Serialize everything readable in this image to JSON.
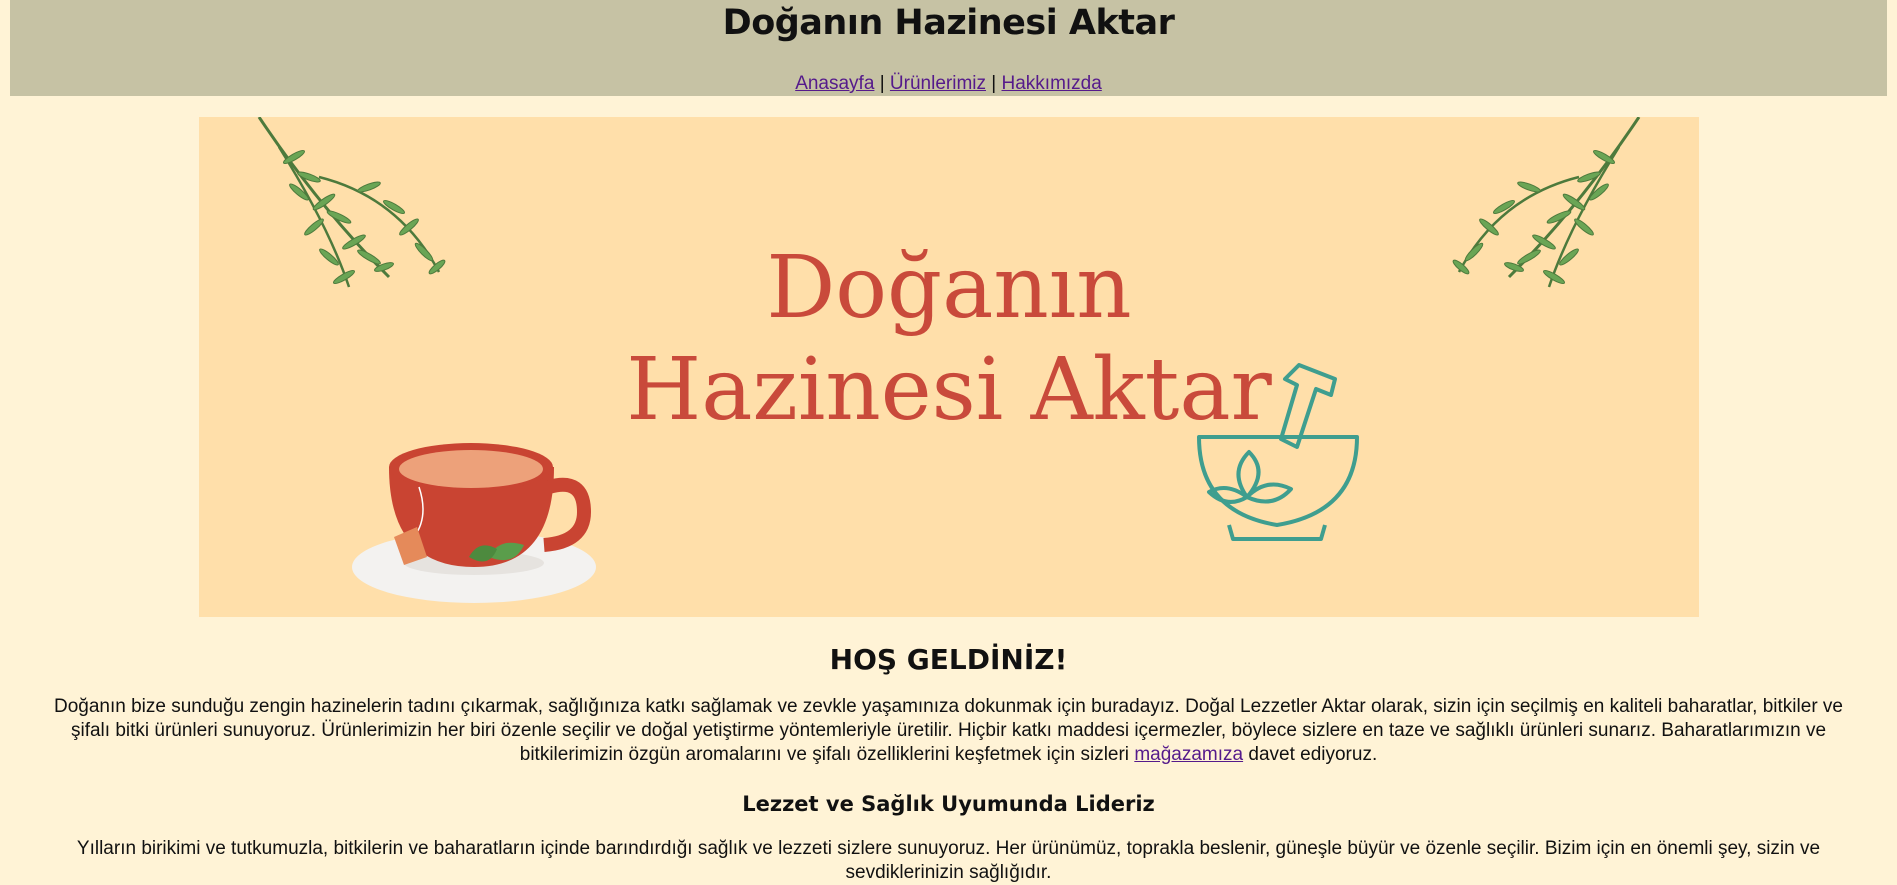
{
  "header": {
    "title": "Doğanın Hazinesi Aktar",
    "nav": {
      "home": "Anasayfa",
      "products": "Ürünlerimiz",
      "about": "Hakkımızda",
      "separator": "|"
    }
  },
  "banner": {
    "line1": "Doğanın",
    "line2": "Hazinesi Aktar",
    "icons": [
      "herb-branch-icon",
      "tea-cup-icon",
      "mortar-pestle-icon"
    ]
  },
  "main": {
    "welcome_heading": "HOŞ GELDİNİZ!",
    "intro_text_before": "Doğanın bize sunduğu zengin hazinelerin tadını çıkarmak, sağlığınıza katkı sağlamak ve zevkle yaşamınıza dokunmak için buradayız. Doğal Lezzetler Aktar olarak, sizin için seçilmiş en kaliteli baharatlar, bitkiler ve şifalı bitki ürünleri sunuyoruz. Ürünlerimizin her biri özenle seçilir ve doğal yetiştirme yöntemleriyle üretilir. Hiçbir katkı maddesi içermezler, böylece sizlere en taze ve sağlıklı ürünleri sunarız. Baharatlarımızın ve bitkilerimizin özgün aromalarını ve şifalı özelliklerini keşfetmek için sizleri ",
    "intro_link": "mağazamıza",
    "intro_text_after": " davet ediyoruz.",
    "sub_heading": "Lezzet ve Sağlık Uyumunda Lideriz",
    "story_text": "Yılların birikimi ve tutkumuzla, bitkilerin ve baharatların içinde barındırdığı sağlık ve lezzeti sizlere sunuyoruz. Her ürünümüz, toprakla beslenir, güneşle büyür ve özenle seçilir. Bizim için en önemli şey, sizin ve sevdiklerinizin sağlığıdır."
  },
  "colors": {
    "page_bg": "#fff3d6",
    "header_bg": "#c6c2a4",
    "banner_bg": "#ffdfaa",
    "banner_text": "#c94a3b",
    "cup_red": "#c94432",
    "mortar_teal": "#3f9e8f",
    "herb_green": "#5e9a4e",
    "link": "#551a8b"
  }
}
